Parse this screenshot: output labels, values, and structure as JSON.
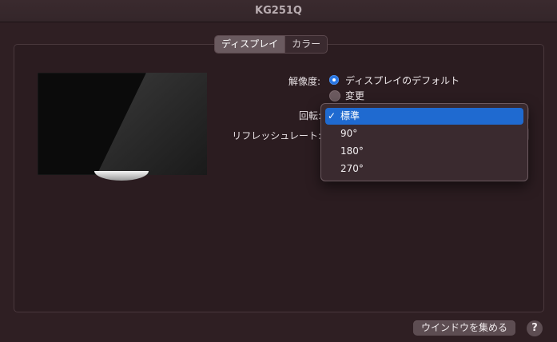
{
  "window": {
    "title": "KG251Q"
  },
  "tabs": [
    {
      "label": "ディスプレイ",
      "active": true
    },
    {
      "label": "カラー",
      "active": false
    }
  ],
  "resolution": {
    "label": "解像度:",
    "options": [
      {
        "label": "ディスプレイのデフォルト",
        "selected": true
      },
      {
        "label": "変更",
        "selected": false
      }
    ]
  },
  "rotation": {
    "label": "回転:",
    "menu_items": [
      {
        "label": "標準",
        "checked": true
      },
      {
        "label": "90°",
        "checked": false
      },
      {
        "label": "180°",
        "checked": false
      },
      {
        "label": "270°",
        "checked": false
      }
    ]
  },
  "refresh_rate": {
    "label": "リフレッシュレート:"
  },
  "buttons": {
    "gather_windows": "ウインドウを集める",
    "help": "?"
  },
  "colors": {
    "accent": "#1f6ad0",
    "window_bg": "#2f1f23"
  }
}
